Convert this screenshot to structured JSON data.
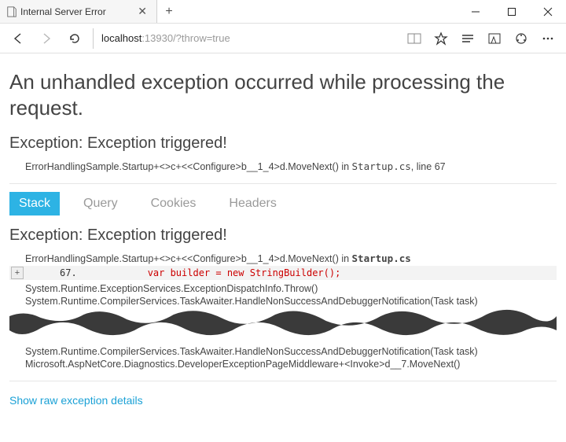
{
  "browser": {
    "tab_title": "Internal Server Error",
    "url_host": "localhost",
    "url_rest": ":13930/?throw=true"
  },
  "page": {
    "title": "An unhandled exception occurred while processing the request.",
    "exception_heading": "Exception: Exception triggered!",
    "top_trace_text": "ErrorHandlingSample.Startup+<>c+<<Configure>b__1_4>d.MoveNext() in ",
    "top_trace_file": "Startup.cs",
    "top_trace_line_prefix": ", line ",
    "top_trace_line": "67"
  },
  "tabs": {
    "stack": "Stack",
    "query": "Query",
    "cookies": "Cookies",
    "headers": "Headers"
  },
  "stack": {
    "heading": "Exception: Exception triggered!",
    "frame0_text": "ErrorHandlingSample.Startup+<>c+<<Configure>b__1_4>d.MoveNext() in ",
    "frame0_file": "Startup.cs",
    "line_number": "67.",
    "code_line": "var builder = new StringBuilder();",
    "frame1": "System.Runtime.ExceptionServices.ExceptionDispatchInfo.Throw()",
    "frame2": "System.Runtime.CompilerServices.TaskAwaiter.HandleNonSuccessAndDebuggerNotification(Task task)",
    "frame3": "System.Runtime.CompilerServices.TaskAwaiter.HandleNonSuccessAndDebuggerNotification(Task task)",
    "frame4": "Microsoft.AspNetCore.Diagnostics.DeveloperExceptionPageMiddleware+<Invoke>d__7.MoveNext()"
  },
  "show_raw": "Show raw exception details"
}
